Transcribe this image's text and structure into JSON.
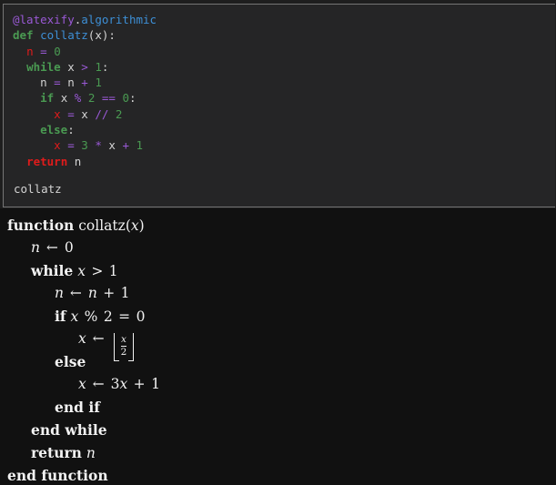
{
  "theme": {
    "page_bg": "#1e1e1e",
    "code_cell_bg": "#252526",
    "code_cell_border": "#757575",
    "latex_panel_bg": "#111111",
    "latex_text": "#f2f2f2",
    "token_decorator": "#9a59d6",
    "token_attribute": "#3d8fd6",
    "token_keyword": "#4a9a52",
    "token_return": "#e01b1b",
    "token_function": "#3d8fd6",
    "token_operator": "#9a59d6",
    "token_number": "#4a9a52",
    "token_target": "#e01b1b",
    "token_plain": "#d4d4d4"
  },
  "code_cell": {
    "language": "python",
    "lines": [
      {
        "indent": 0,
        "tokens": [
          {
            "t": "@latexify",
            "c": "tk-dec"
          },
          {
            "t": ".",
            "c": "tk-dot"
          },
          {
            "t": "algorithmic",
            "c": "tk-attr"
          }
        ]
      },
      {
        "indent": 0,
        "tokens": [
          {
            "t": "def",
            "c": "tk-kw"
          },
          {
            "t": " ",
            "c": "tk-plain"
          },
          {
            "t": "collatz",
            "c": "tk-fn"
          },
          {
            "t": "(x):",
            "c": "tk-plain"
          }
        ]
      },
      {
        "indent": 1,
        "tokens": [
          {
            "t": "n",
            "c": "tk-target"
          },
          {
            "t": " ",
            "c": "tk-plain"
          },
          {
            "t": "=",
            "c": "tk-op"
          },
          {
            "t": " ",
            "c": "tk-plain"
          },
          {
            "t": "0",
            "c": "tk-num"
          }
        ]
      },
      {
        "indent": 1,
        "tokens": [
          {
            "t": "while",
            "c": "tk-kw"
          },
          {
            "t": " x ",
            "c": "tk-plain"
          },
          {
            "t": ">",
            "c": "tk-op"
          },
          {
            "t": " ",
            "c": "tk-plain"
          },
          {
            "t": "1",
            "c": "tk-num"
          },
          {
            "t": ":",
            "c": "tk-plain"
          }
        ]
      },
      {
        "indent": 2,
        "tokens": [
          {
            "t": "n",
            "c": "tk-plain"
          },
          {
            "t": " ",
            "c": "tk-plain"
          },
          {
            "t": "=",
            "c": "tk-op"
          },
          {
            "t": " n ",
            "c": "tk-plain"
          },
          {
            "t": "+",
            "c": "tk-op"
          },
          {
            "t": " ",
            "c": "tk-plain"
          },
          {
            "t": "1",
            "c": "tk-num"
          }
        ]
      },
      {
        "indent": 2,
        "tokens": [
          {
            "t": "if",
            "c": "tk-kw"
          },
          {
            "t": " x ",
            "c": "tk-plain"
          },
          {
            "t": "%",
            "c": "tk-op"
          },
          {
            "t": " ",
            "c": "tk-plain"
          },
          {
            "t": "2",
            "c": "tk-num"
          },
          {
            "t": " ",
            "c": "tk-plain"
          },
          {
            "t": "==",
            "c": "tk-op"
          },
          {
            "t": " ",
            "c": "tk-plain"
          },
          {
            "t": "0",
            "c": "tk-num"
          },
          {
            "t": ":",
            "c": "tk-plain"
          }
        ]
      },
      {
        "indent": 3,
        "tokens": [
          {
            "t": "x",
            "c": "tk-target"
          },
          {
            "t": " ",
            "c": "tk-plain"
          },
          {
            "t": "=",
            "c": "tk-op"
          },
          {
            "t": " x ",
            "c": "tk-plain"
          },
          {
            "t": "//",
            "c": "tk-op"
          },
          {
            "t": " ",
            "c": "tk-plain"
          },
          {
            "t": "2",
            "c": "tk-num"
          }
        ]
      },
      {
        "indent": 2,
        "tokens": [
          {
            "t": "else",
            "c": "tk-kw"
          },
          {
            "t": ":",
            "c": "tk-plain"
          }
        ]
      },
      {
        "indent": 3,
        "tokens": [
          {
            "t": "x",
            "c": "tk-target"
          },
          {
            "t": " ",
            "c": "tk-plain"
          },
          {
            "t": "=",
            "c": "tk-op"
          },
          {
            "t": " ",
            "c": "tk-plain"
          },
          {
            "t": "3",
            "c": "tk-num"
          },
          {
            "t": " ",
            "c": "tk-plain"
          },
          {
            "t": "*",
            "c": "tk-op"
          },
          {
            "t": " x ",
            "c": "tk-plain"
          },
          {
            "t": "+",
            "c": "tk-op"
          },
          {
            "t": " ",
            "c": "tk-plain"
          },
          {
            "t": "1",
            "c": "tk-num"
          }
        ]
      },
      {
        "indent": 1,
        "tokens": [
          {
            "t": "return",
            "c": "tk-kwret"
          },
          {
            "t": " n",
            "c": "tk-plain"
          }
        ]
      }
    ]
  },
  "cell_output": {
    "text": "collatz"
  },
  "latex_output": {
    "lines": [
      {
        "indent": 0,
        "parts": [
          {
            "t": "function",
            "c": "tex-kw"
          },
          {
            "t": " ",
            "c": "tex-rm"
          },
          {
            "t": "collatz(",
            "c": "tex-rm"
          },
          {
            "t": "x",
            "c": "tex-var"
          },
          {
            "t": ")",
            "c": "tex-rm"
          }
        ]
      },
      {
        "indent": 1,
        "parts": [
          {
            "t": "n",
            "c": "tex-var"
          },
          {
            "t": " ← ",
            "c": "tex-arrow"
          },
          {
            "t": "0",
            "c": "tex-num"
          }
        ]
      },
      {
        "indent": 1,
        "parts": [
          {
            "t": "while",
            "c": "tex-kw"
          },
          {
            "t": " ",
            "c": "tex-rm"
          },
          {
            "t": "x",
            "c": "tex-var"
          },
          {
            "t": " > ",
            "c": "tex-op"
          },
          {
            "t": "1",
            "c": "tex-num"
          }
        ]
      },
      {
        "indent": 2,
        "parts": [
          {
            "t": "n",
            "c": "tex-var"
          },
          {
            "t": " ← ",
            "c": "tex-arrow"
          },
          {
            "t": "n",
            "c": "tex-var"
          },
          {
            "t": " + ",
            "c": "tex-op"
          },
          {
            "t": "1",
            "c": "tex-num"
          }
        ]
      },
      {
        "indent": 2,
        "parts": [
          {
            "t": "if",
            "c": "tex-kw"
          },
          {
            "t": " ",
            "c": "tex-rm"
          },
          {
            "t": "x",
            "c": "tex-var"
          },
          {
            "t": " % ",
            "c": "tex-op"
          },
          {
            "t": "2",
            "c": "tex-num"
          },
          {
            "t": " = ",
            "c": "tex-op"
          },
          {
            "t": "0",
            "c": "tex-num"
          }
        ]
      },
      {
        "indent": 3,
        "floor": true,
        "parts": [
          {
            "t": "x",
            "c": "tex-var"
          },
          {
            "t": " ← ",
            "c": "tex-arrow"
          }
        ],
        "floor_numer": "x",
        "floor_denom": "2"
      },
      {
        "indent": 2,
        "parts": [
          {
            "t": "else",
            "c": "tex-kw"
          }
        ]
      },
      {
        "indent": 3,
        "parts": [
          {
            "t": "x",
            "c": "tex-var"
          },
          {
            "t": " ← ",
            "c": "tex-arrow"
          },
          {
            "t": "3",
            "c": "tex-num"
          },
          {
            "t": "x",
            "c": "tex-var"
          },
          {
            "t": " + ",
            "c": "tex-op"
          },
          {
            "t": "1",
            "c": "tex-num"
          }
        ]
      },
      {
        "indent": 2,
        "parts": [
          {
            "t": "end if",
            "c": "tex-kw"
          }
        ]
      },
      {
        "indent": 1,
        "parts": [
          {
            "t": "end while",
            "c": "tex-kw"
          }
        ]
      },
      {
        "indent": 1,
        "parts": [
          {
            "t": "return",
            "c": "tex-kw"
          },
          {
            "t": " ",
            "c": "tex-rm"
          },
          {
            "t": "n",
            "c": "tex-var"
          }
        ]
      },
      {
        "indent": 0,
        "parts": [
          {
            "t": "end function",
            "c": "tex-kw"
          }
        ]
      }
    ]
  }
}
